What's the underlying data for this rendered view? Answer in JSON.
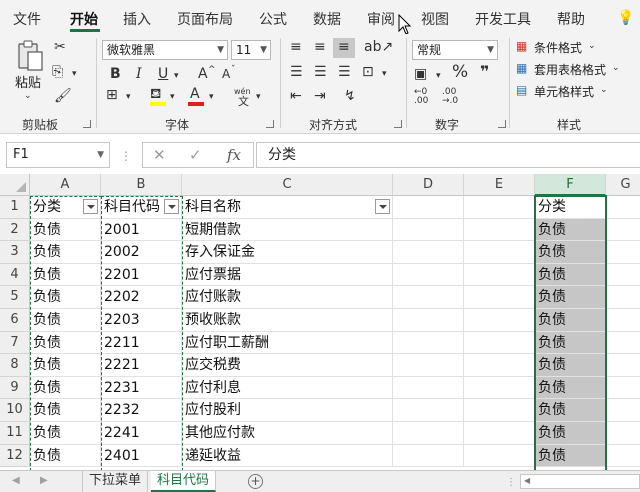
{
  "ribbon_tabs": [
    "文件",
    "开始",
    "插入",
    "页面布局",
    "公式",
    "数据",
    "审阅",
    "视图",
    "开发工具",
    "帮助"
  ],
  "active_tab": "开始",
  "clipboard": {
    "paste_label": "粘贴",
    "group_label": "剪贴板"
  },
  "font": {
    "name": "微软雅黑",
    "size": "11",
    "bold": "B",
    "italic": "I",
    "underline": "U",
    "grow": "A",
    "shrink": "A",
    "wen": "wén",
    "group_label": "字体",
    "highlight_color": "#ffff00",
    "font_color": "#e02020"
  },
  "alignment": {
    "group_label": "对齐方式"
  },
  "number": {
    "format": "常规",
    "percent": "%",
    "comma": "❞",
    "group_label": "数字"
  },
  "styles": {
    "conditional": "条件格式",
    "table": "套用表格格式",
    "cell": "单元格样式",
    "group_label": "样式"
  },
  "formula_bar": {
    "name_box": "F1",
    "cancel": "✕",
    "enter": "✓",
    "fx": "fx",
    "content": "分类"
  },
  "columns": [
    "A",
    "B",
    "C",
    "D",
    "E",
    "F",
    "G"
  ],
  "selected_column": "F",
  "rows": [
    {
      "num": "1",
      "a": "分类",
      "b": "科目代码",
      "c": "科目名称",
      "f": "分类"
    },
    {
      "num": "2",
      "a": "负债",
      "b": "2001",
      "c": "短期借款",
      "f": "负债"
    },
    {
      "num": "3",
      "a": "负债",
      "b": "2002",
      "c": "存入保证金",
      "f": "负债"
    },
    {
      "num": "4",
      "a": "负债",
      "b": "2201",
      "c": "应付票据",
      "f": "负债"
    },
    {
      "num": "5",
      "a": "负债",
      "b": "2202",
      "c": "应付账款",
      "f": "负债"
    },
    {
      "num": "6",
      "a": "负债",
      "b": "2203",
      "c": "预收账款",
      "f": "负债"
    },
    {
      "num": "7",
      "a": "负债",
      "b": "2211",
      "c": "应付职工薪酬",
      "f": "负债"
    },
    {
      "num": "8",
      "a": "负债",
      "b": "2221",
      "c": "应交税费",
      "f": "负债"
    },
    {
      "num": "9",
      "a": "负债",
      "b": "2231",
      "c": "应付利息",
      "f": "负债"
    },
    {
      "num": "10",
      "a": "负债",
      "b": "2232",
      "c": "应付股利",
      "f": "负债"
    },
    {
      "num": "11",
      "a": "负债",
      "b": "2241",
      "c": "其他应付款",
      "f": "负债"
    },
    {
      "num": "12",
      "a": "负债",
      "b": "2401",
      "c": "递延收益",
      "f": "负债"
    }
  ],
  "sheets": [
    "下拉菜单",
    "科目代码"
  ],
  "active_sheet": "科目代码",
  "accent_color": "#217346"
}
